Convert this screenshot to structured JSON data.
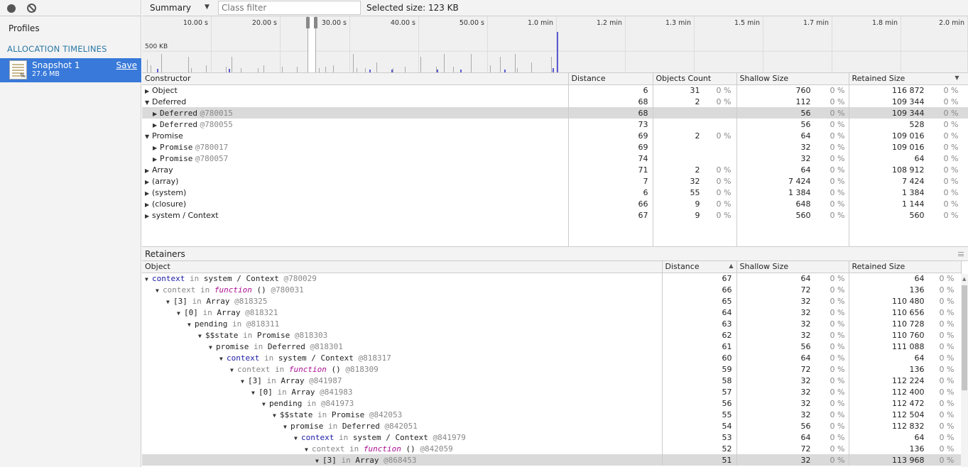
{
  "sidebar": {
    "profiles_title": "Profiles",
    "section_title": "ALLOCATION TIMELINES",
    "snapshot": {
      "name": "Snapshot 1",
      "size": "27.6 MB",
      "save_label": "Save"
    }
  },
  "toolbar": {
    "view": "Summary",
    "class_filter_placeholder": "Class filter",
    "selected_size": "Selected size: 123 KB"
  },
  "overview": {
    "ticks": [
      "10.00 s",
      "20.00 s",
      "30.00 s",
      "40.00 s",
      "50.00 s",
      "1.0 min",
      "1.2 min",
      "1.3 min",
      "1.5 min",
      "1.7 min",
      "1.8 min",
      "2.0 min"
    ],
    "y_label": "500 KB"
  },
  "summary": {
    "headers": {
      "constructor": "Constructor",
      "distance": "Distance",
      "objects_count": "Objects Count",
      "shallow_size": "Shallow Size",
      "retained_size": "Retained Size"
    },
    "rows": [
      {
        "name": "Object",
        "id": "",
        "expanded": false,
        "indent": 0,
        "mono": false,
        "distance": "6",
        "count": "31",
        "count_pct": "0 %",
        "shallow": "760",
        "shallow_pct": "0 %",
        "retained": "116 872",
        "retained_pct": "0 %"
      },
      {
        "name": "Deferred",
        "id": "",
        "expanded": true,
        "indent": 0,
        "mono": false,
        "distance": "68",
        "count": "2",
        "count_pct": "0 %",
        "shallow": "112",
        "shallow_pct": "0 %",
        "retained": "109 344",
        "retained_pct": "0 %"
      },
      {
        "name": "Deferred",
        "id": "@780015",
        "expanded": false,
        "indent": 1,
        "mono": true,
        "selected": true,
        "distance": "68",
        "count": "",
        "count_pct": "",
        "shallow": "56",
        "shallow_pct": "0 %",
        "retained": "109 344",
        "retained_pct": "0 %"
      },
      {
        "name": "Deferred",
        "id": "@780055",
        "expanded": false,
        "indent": 1,
        "mono": true,
        "distance": "73",
        "count": "",
        "count_pct": "",
        "shallow": "56",
        "shallow_pct": "0 %",
        "retained": "528",
        "retained_pct": "0 %"
      },
      {
        "name": "Promise",
        "id": "",
        "expanded": true,
        "indent": 0,
        "mono": false,
        "distance": "69",
        "count": "2",
        "count_pct": "0 %",
        "shallow": "64",
        "shallow_pct": "0 %",
        "retained": "109 016",
        "retained_pct": "0 %"
      },
      {
        "name": "Promise",
        "id": "@780017",
        "expanded": false,
        "indent": 1,
        "mono": true,
        "distance": "69",
        "count": "",
        "count_pct": "",
        "shallow": "32",
        "shallow_pct": "0 %",
        "retained": "109 016",
        "retained_pct": "0 %"
      },
      {
        "name": "Promise",
        "id": "@780057",
        "expanded": false,
        "indent": 1,
        "mono": true,
        "distance": "74",
        "count": "",
        "count_pct": "",
        "shallow": "32",
        "shallow_pct": "0 %",
        "retained": "64",
        "retained_pct": "0 %"
      },
      {
        "name": "Array",
        "id": "",
        "expanded": false,
        "indent": 0,
        "mono": false,
        "distance": "71",
        "count": "2",
        "count_pct": "0 %",
        "shallow": "64",
        "shallow_pct": "0 %",
        "retained": "108 912",
        "retained_pct": "0 %"
      },
      {
        "name": "(array)",
        "id": "",
        "expanded": false,
        "indent": 0,
        "mono": false,
        "distance": "7",
        "count": "32",
        "count_pct": "0 %",
        "shallow": "7 424",
        "shallow_pct": "0 %",
        "retained": "7 424",
        "retained_pct": "0 %"
      },
      {
        "name": "(system)",
        "id": "",
        "expanded": false,
        "indent": 0,
        "mono": false,
        "distance": "6",
        "count": "55",
        "count_pct": "0 %",
        "shallow": "1 384",
        "shallow_pct": "0 %",
        "retained": "1 384",
        "retained_pct": "0 %"
      },
      {
        "name": "(closure)",
        "id": "",
        "expanded": false,
        "indent": 0,
        "mono": false,
        "distance": "66",
        "count": "9",
        "count_pct": "0 %",
        "shallow": "648",
        "shallow_pct": "0 %",
        "retained": "1 144",
        "retained_pct": "0 %"
      },
      {
        "name": "system / Context",
        "id": "",
        "expanded": false,
        "indent": 0,
        "mono": false,
        "distance": "67",
        "count": "9",
        "count_pct": "0 %",
        "shallow": "560",
        "shallow_pct": "0 %",
        "retained": "560",
        "retained_pct": "0 %"
      }
    ]
  },
  "retainers": {
    "title": "Retainers",
    "headers": {
      "object": "Object",
      "distance": "Distance",
      "shallow_size": "Shallow Size",
      "retained_size": "Retained Size"
    },
    "rows": [
      {
        "prop": "context",
        "prop_style": "prop",
        "kw": "in",
        "type": "system / Context",
        "type_style": "",
        "id": "@780029",
        "distance": "67",
        "shallow": "64",
        "shallow_pct": "0 %",
        "retained": "64",
        "retained_pct": "0 %"
      },
      {
        "prop": "context",
        "prop_style": "kw",
        "kw": "in",
        "type": "function",
        "type_style": "fn",
        "suffix": "()",
        "id": "@780031",
        "distance": "66",
        "shallow": "72",
        "shallow_pct": "0 %",
        "retained": "136",
        "retained_pct": "0 %"
      },
      {
        "prop": "[3]",
        "prop_style": "",
        "kw": "in",
        "type": "Array",
        "type_style": "",
        "id": "@818325",
        "distance": "65",
        "shallow": "32",
        "shallow_pct": "0 %",
        "retained": "110 480",
        "retained_pct": "0 %"
      },
      {
        "prop": "[0]",
        "prop_style": "",
        "kw": "in",
        "type": "Array",
        "type_style": "",
        "id": "@818321",
        "distance": "64",
        "shallow": "32",
        "shallow_pct": "0 %",
        "retained": "110 656",
        "retained_pct": "0 %"
      },
      {
        "prop": "pending",
        "prop_style": "",
        "kw": "in",
        "type": "",
        "type_style": "",
        "id": "@818311",
        "distance": "63",
        "shallow": "32",
        "shallow_pct": "0 %",
        "retained": "110 728",
        "retained_pct": "0 %"
      },
      {
        "prop": "$$state",
        "prop_style": "",
        "kw": "in",
        "type": "Promise",
        "type_style": "",
        "id": "@818303",
        "distance": "62",
        "shallow": "32",
        "shallow_pct": "0 %",
        "retained": "110 760",
        "retained_pct": "0 %"
      },
      {
        "prop": "promise",
        "prop_style": "",
        "kw": "in",
        "type": "Deferred",
        "type_style": "",
        "id": "@818301",
        "distance": "61",
        "shallow": "56",
        "shallow_pct": "0 %",
        "retained": "111 088",
        "retained_pct": "0 %"
      },
      {
        "prop": "context",
        "prop_style": "prop",
        "kw": "in",
        "type": "system / Context",
        "type_style": "",
        "id": "@818317",
        "distance": "60",
        "shallow": "64",
        "shallow_pct": "0 %",
        "retained": "64",
        "retained_pct": "0 %"
      },
      {
        "prop": "context",
        "prop_style": "kw",
        "kw": "in",
        "type": "function",
        "type_style": "fn",
        "suffix": "()",
        "id": "@818309",
        "distance": "59",
        "shallow": "72",
        "shallow_pct": "0 %",
        "retained": "136",
        "retained_pct": "0 %"
      },
      {
        "prop": "[3]",
        "prop_style": "",
        "kw": "in",
        "type": "Array",
        "type_style": "",
        "id": "@841987",
        "distance": "58",
        "shallow": "32",
        "shallow_pct": "0 %",
        "retained": "112 224",
        "retained_pct": "0 %"
      },
      {
        "prop": "[0]",
        "prop_style": "",
        "kw": "in",
        "type": "Array",
        "type_style": "",
        "id": "@841983",
        "distance": "57",
        "shallow": "32",
        "shallow_pct": "0 %",
        "retained": "112 400",
        "retained_pct": "0 %"
      },
      {
        "prop": "pending",
        "prop_style": "",
        "kw": "in",
        "type": "",
        "type_style": "",
        "id": "@841973",
        "distance": "56",
        "shallow": "32",
        "shallow_pct": "0 %",
        "retained": "112 472",
        "retained_pct": "0 %"
      },
      {
        "prop": "$$state",
        "prop_style": "",
        "kw": "in",
        "type": "Promise",
        "type_style": "",
        "id": "@842053",
        "distance": "55",
        "shallow": "32",
        "shallow_pct": "0 %",
        "retained": "112 504",
        "retained_pct": "0 %"
      },
      {
        "prop": "promise",
        "prop_style": "",
        "kw": "in",
        "type": "Deferred",
        "type_style": "",
        "id": "@842051",
        "distance": "54",
        "shallow": "56",
        "shallow_pct": "0 %",
        "retained": "112 832",
        "retained_pct": "0 %"
      },
      {
        "prop": "context",
        "prop_style": "prop",
        "kw": "in",
        "type": "system / Context",
        "type_style": "",
        "id": "@841979",
        "distance": "53",
        "shallow": "64",
        "shallow_pct": "0 %",
        "retained": "64",
        "retained_pct": "0 %"
      },
      {
        "prop": "context",
        "prop_style": "kw",
        "kw": "in",
        "type": "function",
        "type_style": "fn",
        "suffix": "()",
        "id": "@842059",
        "distance": "52",
        "shallow": "72",
        "shallow_pct": "0 %",
        "retained": "136",
        "retained_pct": "0 %"
      },
      {
        "prop": "[3]",
        "prop_style": "",
        "kw": "in",
        "type": "Array",
        "type_style": "",
        "id": "@868453",
        "distance": "51",
        "shallow": "32",
        "shallow_pct": "0 %",
        "retained": "113 968",
        "retained_pct": "0 %",
        "highlight": true
      }
    ]
  }
}
